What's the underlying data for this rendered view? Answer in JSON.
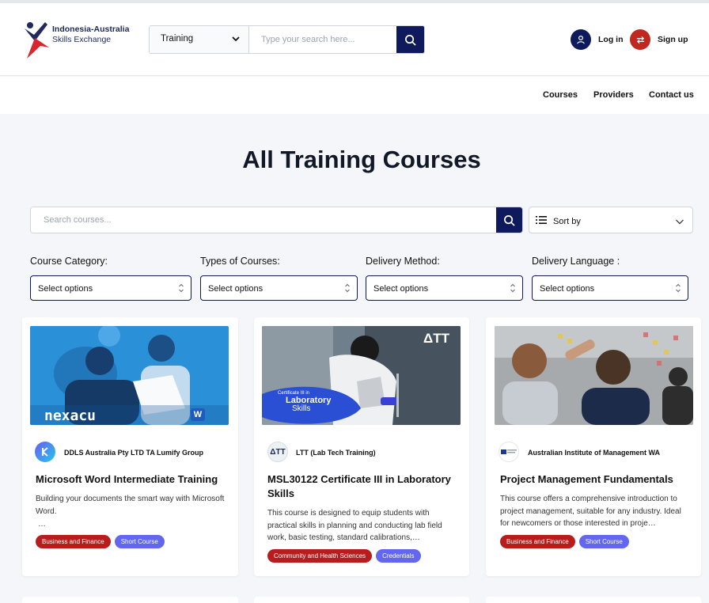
{
  "header": {
    "logo_line1": "Indonesia-Australia",
    "logo_line2": "Skills Exchange",
    "search": {
      "category": "Training",
      "placeholder": "Type your search here..."
    },
    "login_label": "Log in",
    "signup_label": "Sign up"
  },
  "nav": {
    "links": [
      "Courses",
      "Providers",
      "Contact us"
    ]
  },
  "page": {
    "title": "All Training Courses"
  },
  "filters": {
    "search_placeholder": "Search courses...",
    "sort_label": "Sort by",
    "select_placeholder": "Select options",
    "labels": [
      "Course Category:",
      "Types of Courses:",
      "Delivery Method:",
      "Delivery Language :"
    ]
  },
  "courses": [
    {
      "provider": "DDLS Australia Pty LTD TA Lumify Group",
      "title": "Microsoft Word Intermediate Training",
      "description": "Building your documents the smart way with Microsoft Word.",
      "description_more": "…",
      "image_text": "nexacu",
      "tags": [
        "Business and Finance",
        "Short Course"
      ]
    },
    {
      "provider": "LTT (Lab Tech Training)",
      "title": "MSL30122 Certificate III in Laboratory Skills",
      "description": "This course is designed to equip students with practical skills in planning and conducting lab field work, basic testing, standard calibrations,…",
      "image_badge_line1": "Certificate III in",
      "image_badge_line2": "Laboratory",
      "image_badge_line3": "Skills",
      "image_logo": "ΔTT",
      "provider_logo": "ΔTT",
      "tags": [
        "Community and Health Sciences",
        "Credentials"
      ]
    },
    {
      "provider": "Australian Institute of Management WA",
      "title": "Project Management Fundamentals",
      "description": "This course offers a comprehensive introduction to project management, suitable for any industry. Ideal for newcomers or those interested in proje…",
      "tags": [
        "Business and Finance",
        "Short Course"
      ]
    }
  ],
  "colors": {
    "navy": "#0f1a5c",
    "tag_red": "#b91c1c",
    "tag_purple": "#6366f1",
    "signup_red": "#c0281f"
  }
}
